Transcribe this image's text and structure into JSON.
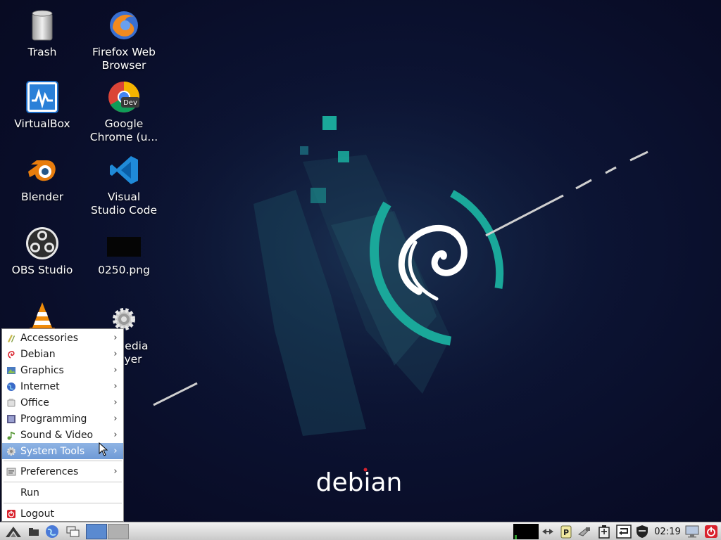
{
  "desktop": {
    "icons": [
      {
        "label": "Trash",
        "icon": "trash-icon"
      },
      {
        "label": "Firefox Web\nBrowser",
        "icon": "firefox-icon"
      },
      {
        "label": "VirtualBox",
        "icon": "virtualbox-icon"
      },
      {
        "label": "Google\nChrome (u...",
        "icon": "chrome-dev-icon"
      },
      {
        "label": "Blender",
        "icon": "blender-icon"
      },
      {
        "label": "Visual\nStudio Code",
        "icon": "vscode-icon"
      },
      {
        "label": "OBS Studio",
        "icon": "obs-icon"
      },
      {
        "label": "0250.png",
        "icon": "image-file-icon"
      },
      {
        "label": "",
        "icon": "vlc-icon"
      },
      {
        "label": "nedia\nyer",
        "icon": "gear-icon"
      }
    ],
    "wallpaper_text": "debian"
  },
  "start_menu": {
    "items": [
      {
        "label": "Accessories",
        "icon": "accessories-icon",
        "submenu": true
      },
      {
        "label": "Debian",
        "icon": "debian-swirl-icon",
        "submenu": true
      },
      {
        "label": "Graphics",
        "icon": "graphics-icon",
        "submenu": true
      },
      {
        "label": "Internet",
        "icon": "globe-icon",
        "submenu": true
      },
      {
        "label": "Office",
        "icon": "office-icon",
        "submenu": true
      },
      {
        "label": "Programming",
        "icon": "programming-icon",
        "submenu": true
      },
      {
        "label": "Sound & Video",
        "icon": "sound-video-icon",
        "submenu": true
      },
      {
        "label": "System Tools",
        "icon": "system-tools-icon",
        "submenu": true,
        "active": true
      },
      {
        "label": "Preferences",
        "icon": "preferences-icon",
        "submenu": true
      },
      {
        "label": "Run",
        "icon": "",
        "submenu": false
      },
      {
        "label": "Logout",
        "icon": "logout-icon",
        "submenu": false
      }
    ],
    "arrow_glyph": "›"
  },
  "taskbar": {
    "clock": "02:19",
    "colors": {
      "accent": "#6f9ad6",
      "teal": "#1aa89a",
      "logout_red": "#d9232e"
    }
  }
}
